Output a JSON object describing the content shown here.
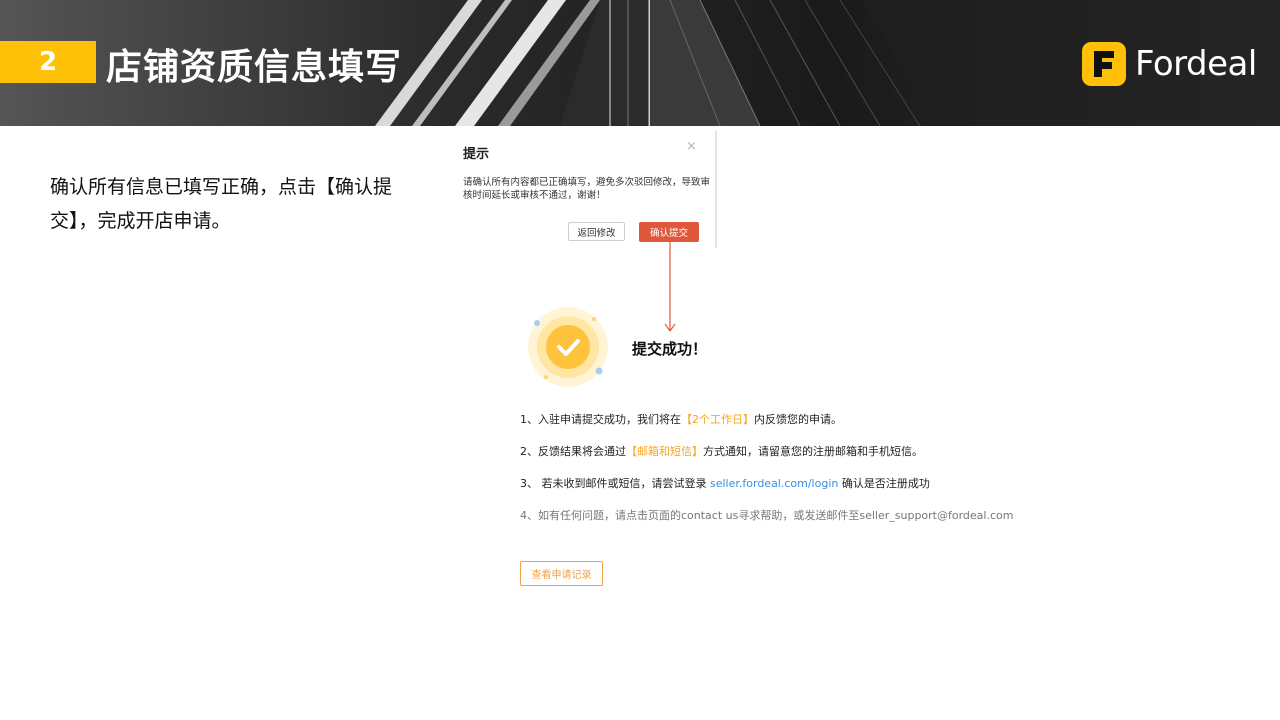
{
  "header": {
    "step_number": "2",
    "title": "店铺资质信息填写",
    "logo_letter": "F",
    "logo_text": "Fordeal"
  },
  "description": "确认所有信息已填写正确，点击【确认提交】，完成开店申请。",
  "dialog": {
    "title": "提示",
    "close_glyph": "×",
    "message": "请确认所有内容都已正确填写，避免多次驳回修改，导致审核时间延长或审核不通过，谢谢！",
    "back_button": "返回修改",
    "confirm_button": "确认提交"
  },
  "success": {
    "title": "提交成功！",
    "line1": {
      "prefix": "1、入驻申请提交成功，我们将在",
      "highlight": "【2个工作日】",
      "suffix": "内反馈您的申请。"
    },
    "line2": {
      "prefix": "2、反馈结果将会通过",
      "highlight": "【邮箱和短信】",
      "suffix": "方式通知，请留意您的注册邮箱和手机短信。"
    },
    "line3": {
      "prefix": "3、 若未收到邮件或短信，请尝试登录 ",
      "link": "seller.fordeal.com/login",
      "suffix": " 确认是否注册成功"
    },
    "line4": "4、如有任何问题，请点击页面的contact us寻求帮助，或发送邮件至seller_support@fordeal.com",
    "record_button": "查看申请记录"
  },
  "colors": {
    "accent_yellow": "#ffc107",
    "confirm_red": "#e0583b",
    "highlight_orange": "#f5a623",
    "link_blue": "#3a8ee6"
  }
}
